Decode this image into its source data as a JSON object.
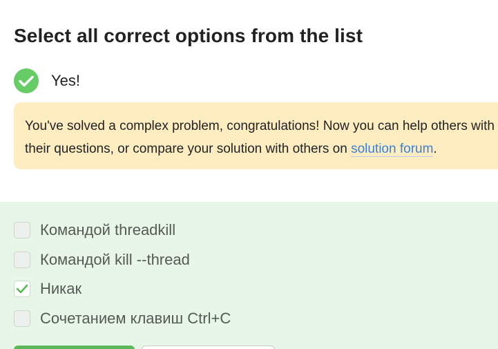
{
  "task": {
    "title": "Select all correct options from the list"
  },
  "result": {
    "status_text": "Yes!",
    "icon": "check-circle-icon",
    "color": "#66cc66"
  },
  "feedback": {
    "line1": "You've solved a complex problem, congratulations! Now you can help others with",
    "line2_prefix": "their questions, or compare your solution with others on ",
    "link_text": "solution forum",
    "line2_suffix": ".",
    "background_color": "#feedc1",
    "link_color": "#3a80d8"
  },
  "options": {
    "background_color": "#e7f6e7",
    "items": [
      {
        "label": "Командой threadkill",
        "checked": false
      },
      {
        "label": "Командой kill --thread",
        "checked": false
      },
      {
        "label": "Никак",
        "checked": true
      },
      {
        "label": "Сочетанием клавиш Ctrl+C",
        "checked": false
      }
    ]
  }
}
